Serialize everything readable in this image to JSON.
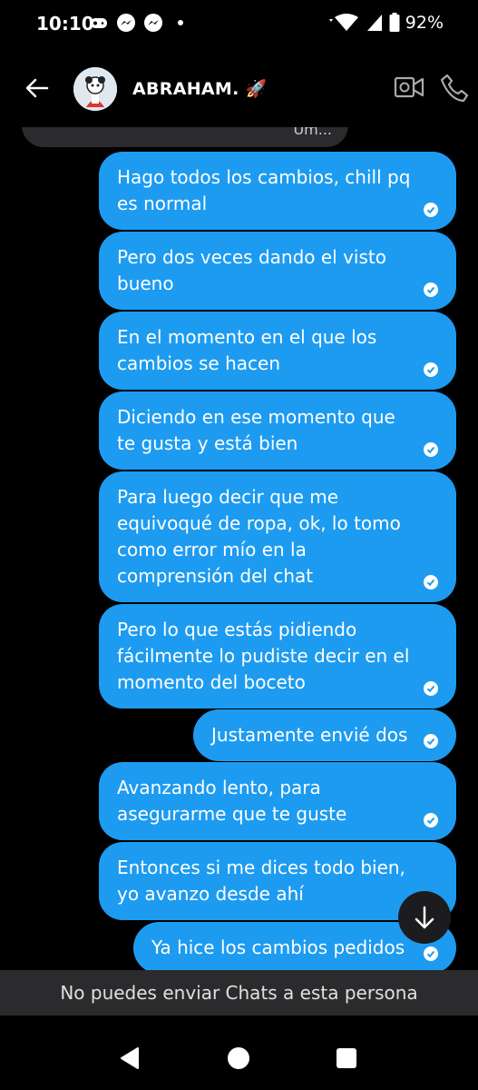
{
  "status": {
    "time": "10:10",
    "battery": "92%"
  },
  "header": {
    "contact_name": "ABRAHAM. 🚀"
  },
  "chat": {
    "previous_fragment": "Um...",
    "messages": [
      {
        "text": "Hago todos los cambios, chill pq es normal"
      },
      {
        "text": "Pero dos veces dando el visto bueno"
      },
      {
        "text": "En el momento en el que los cambios se hacen"
      },
      {
        "text": "Diciendo en ese momento que te gusta y está bien"
      },
      {
        "text": "Para luego decir que me equivoqué de ropa, ok, lo tomo como error mío en la comprensión del chat"
      },
      {
        "text": "Pero lo que estás pidiendo fácilmente lo pudiste decir en el momento del boceto"
      },
      {
        "text": "Justamente envié dos"
      },
      {
        "text": "Avanzando lento, para asegurarme que te guste"
      },
      {
        "text": "Entonces si me dices todo bien, yo avanzo desde ahí"
      },
      {
        "text": "Ya hice los cambios pedidos"
      }
    ]
  },
  "footer": {
    "notice": "No puedes enviar Chats a esta persona"
  },
  "colors": {
    "bubble": "#1d9bf0",
    "background": "#000000",
    "footer": "#2b2b2d"
  }
}
